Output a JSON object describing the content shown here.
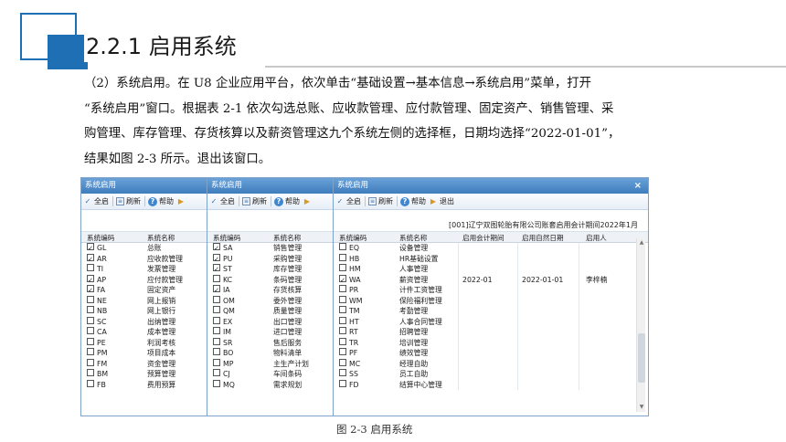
{
  "slide": {
    "title": "2.2.1  启用系统",
    "paragraph_lines": [
      "（2）系统启用。在 U8 企业应用平台，依次单击“基础设置→基本信息→系统启用”菜单，打开",
      "“系统启用”窗口。根据表 2-1 依次勾选总账、应收款管理、应付款管理、固定资产、销售管理、采",
      "购管理、库存管理、存货核算以及薪资管理这九个系统左侧的选择框，日期均选择“2022-01-01”，",
      "结果如图 2-3 所示。退出该窗口。"
    ],
    "caption": "图 2-3  启用系统",
    "accent_color": "#1f6fb5"
  },
  "windows": [
    {
      "title": "系统启用",
      "toolbar": [
        "全启",
        "刷新",
        "帮助"
      ],
      "columns": [
        "系统编码",
        "系统名称"
      ],
      "rows": [
        {
          "checked": true,
          "code": "GL",
          "name": "总账"
        },
        {
          "checked": true,
          "code": "AR",
          "name": "应收款管理"
        },
        {
          "checked": false,
          "code": "TI",
          "name": "发票管理"
        },
        {
          "checked": true,
          "code": "AP",
          "name": "应付款管理"
        },
        {
          "checked": true,
          "code": "FA",
          "name": "固定资产"
        },
        {
          "checked": false,
          "code": "NE",
          "name": "网上报销"
        },
        {
          "checked": false,
          "code": "NB",
          "name": "网上银行"
        },
        {
          "checked": false,
          "code": "SC",
          "name": "出纳管理"
        },
        {
          "checked": false,
          "code": "CA",
          "name": "成本管理"
        },
        {
          "checked": false,
          "code": "PE",
          "name": "利润考核"
        },
        {
          "checked": false,
          "code": "PM",
          "name": "项目成本"
        },
        {
          "checked": false,
          "code": "FM",
          "name": "资金管理"
        },
        {
          "checked": false,
          "code": "BM",
          "name": "预算管理"
        },
        {
          "checked": false,
          "code": "FB",
          "name": "费用预算"
        }
      ]
    },
    {
      "title": "系统启用",
      "toolbar": [
        "全启",
        "刷新",
        "帮助"
      ],
      "columns": [
        "系统编码",
        "系统名称"
      ],
      "rows": [
        {
          "checked": true,
          "code": "SA",
          "name": "销售管理"
        },
        {
          "checked": true,
          "code": "PU",
          "name": "采购管理"
        },
        {
          "checked": true,
          "code": "ST",
          "name": "库存管理"
        },
        {
          "checked": false,
          "code": "KC",
          "name": "条码管理"
        },
        {
          "checked": true,
          "code": "IA",
          "name": "存货核算"
        },
        {
          "checked": false,
          "code": "OM",
          "name": "委外管理"
        },
        {
          "checked": false,
          "code": "QM",
          "name": "质量管理"
        },
        {
          "checked": false,
          "code": "EX",
          "name": "出口管理"
        },
        {
          "checked": false,
          "code": "IM",
          "name": "进口管理"
        },
        {
          "checked": false,
          "code": "SR",
          "name": "售后服务"
        },
        {
          "checked": false,
          "code": "BO",
          "name": "物料清单"
        },
        {
          "checked": false,
          "code": "MP",
          "name": "主生产计划"
        },
        {
          "checked": false,
          "code": "CJ",
          "name": "车间条码"
        },
        {
          "checked": false,
          "code": "MQ",
          "name": "需求规划"
        }
      ]
    },
    {
      "title": "系统启用",
      "close": "×",
      "toolbar": [
        "全启",
        "刷新",
        "帮助",
        "退出"
      ],
      "info": "[001]辽宁双图轮胎有限公司账套启用会计期间2022年1月",
      "columns": [
        "系统编码",
        "系统名称",
        "启用会计期间",
        "启用自然日期",
        "启用人"
      ],
      "rows": [
        {
          "checked": false,
          "code": "EQ",
          "name": "设备管理",
          "period": "",
          "date": "",
          "user": ""
        },
        {
          "checked": false,
          "code": "HB",
          "name": "HR基础设置",
          "period": "",
          "date": "",
          "user": ""
        },
        {
          "checked": false,
          "code": "HM",
          "name": "人事管理",
          "period": "",
          "date": "",
          "user": ""
        },
        {
          "checked": true,
          "code": "WA",
          "name": "薪资管理",
          "period": "2022-01",
          "date": "2022-01-01",
          "user": "李梓楠"
        },
        {
          "checked": false,
          "code": "PR",
          "name": "计件工资管理",
          "period": "",
          "date": "",
          "user": ""
        },
        {
          "checked": false,
          "code": "WM",
          "name": "保险福利管理",
          "period": "",
          "date": "",
          "user": ""
        },
        {
          "checked": false,
          "code": "TM",
          "name": "考勤管理",
          "period": "",
          "date": "",
          "user": ""
        },
        {
          "checked": false,
          "code": "HT",
          "name": "人事合同管理",
          "period": "",
          "date": "",
          "user": ""
        },
        {
          "checked": false,
          "code": "RT",
          "name": "招聘管理",
          "period": "",
          "date": "",
          "user": ""
        },
        {
          "checked": false,
          "code": "TR",
          "name": "培训管理",
          "period": "",
          "date": "",
          "user": ""
        },
        {
          "checked": false,
          "code": "PF",
          "name": "绩效管理",
          "period": "",
          "date": "",
          "user": ""
        },
        {
          "checked": false,
          "code": "MC",
          "name": "经理自助",
          "period": "",
          "date": "",
          "user": ""
        },
        {
          "checked": false,
          "code": "SS",
          "name": "员工自助",
          "period": "",
          "date": "",
          "user": ""
        },
        {
          "checked": false,
          "code": "FD",
          "name": "结算中心管理",
          "period": "",
          "date": "",
          "user": ""
        }
      ]
    }
  ]
}
